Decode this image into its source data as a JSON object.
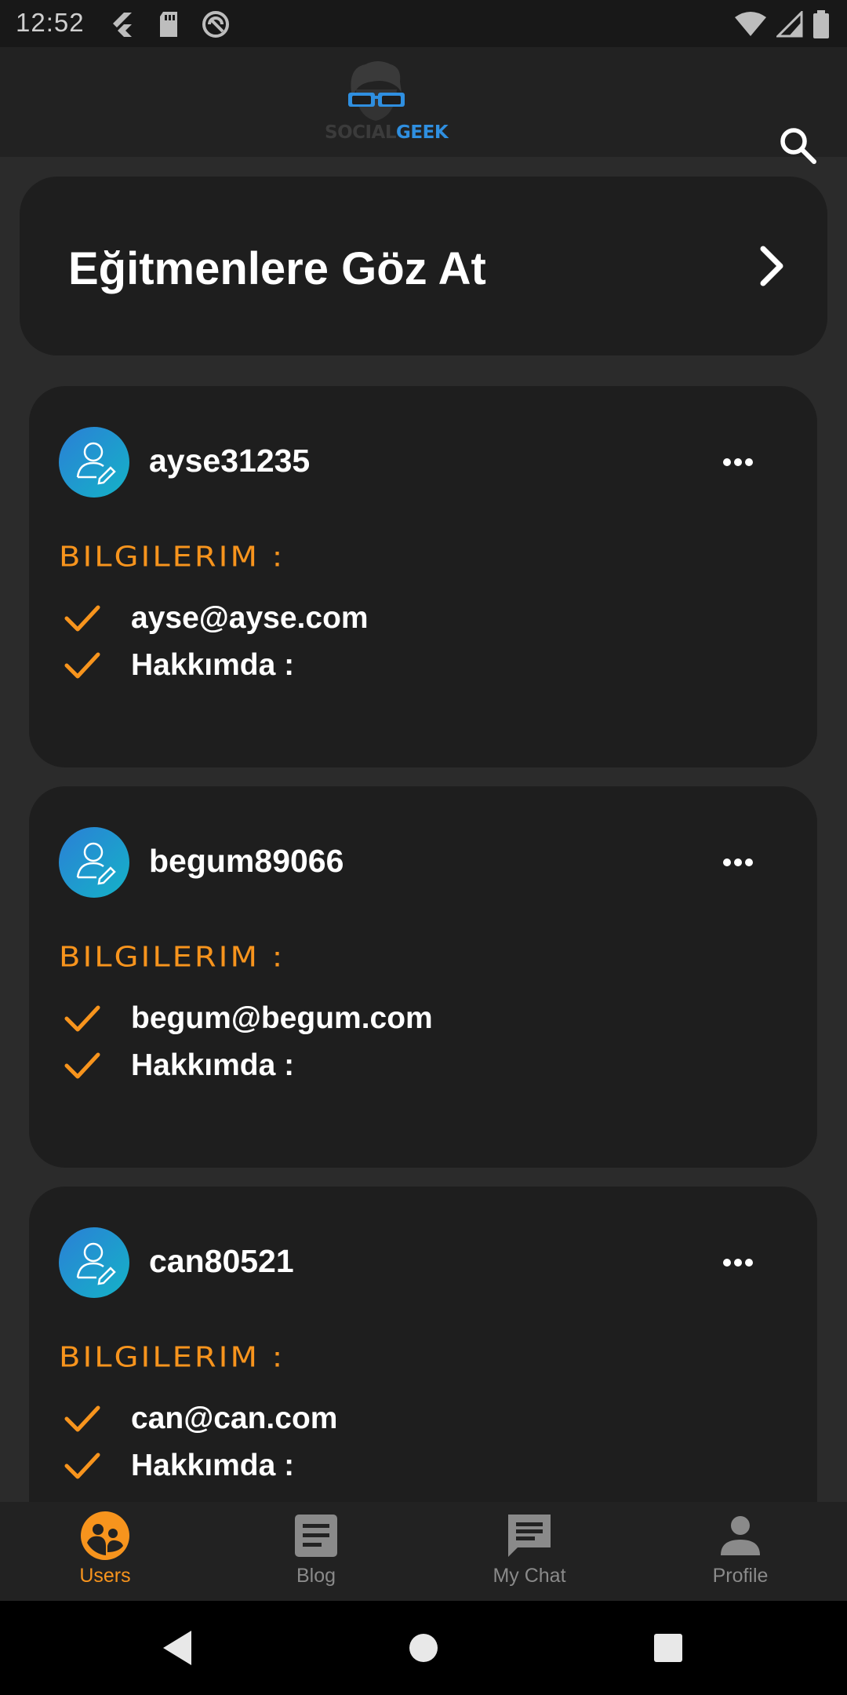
{
  "status_bar": {
    "time": "12:52"
  },
  "app_bar": {
    "logo_left": "SOCIAL",
    "logo_right": "GEEK"
  },
  "banner": {
    "title": "Eğitmenlere Göz At"
  },
  "users": [
    {
      "username": "ayse31235",
      "info_title": "BILGILERIM :",
      "email": "ayse@ayse.com",
      "about": "Hakkımda :"
    },
    {
      "username": "begum89066",
      "info_title": "BILGILERIM :",
      "email": "begum@begum.com",
      "about": "Hakkımda :"
    },
    {
      "username": "can80521",
      "info_title": "BILGILERIM :",
      "email": "can@can.com",
      "about": "Hakkımda :"
    }
  ],
  "bottom_nav": [
    {
      "label": "Users",
      "icon": "users-icon",
      "active": true
    },
    {
      "label": "Blog",
      "icon": "blog-icon",
      "active": false
    },
    {
      "label": "My Chat",
      "icon": "chat-icon",
      "active": false
    },
    {
      "label": "Profile",
      "icon": "profile-icon",
      "active": false
    }
  ],
  "colors": {
    "accent": "#f7941d",
    "inactive": "#8a8a8a",
    "card": "#1e1e1e",
    "background": "#2b2b2b"
  }
}
